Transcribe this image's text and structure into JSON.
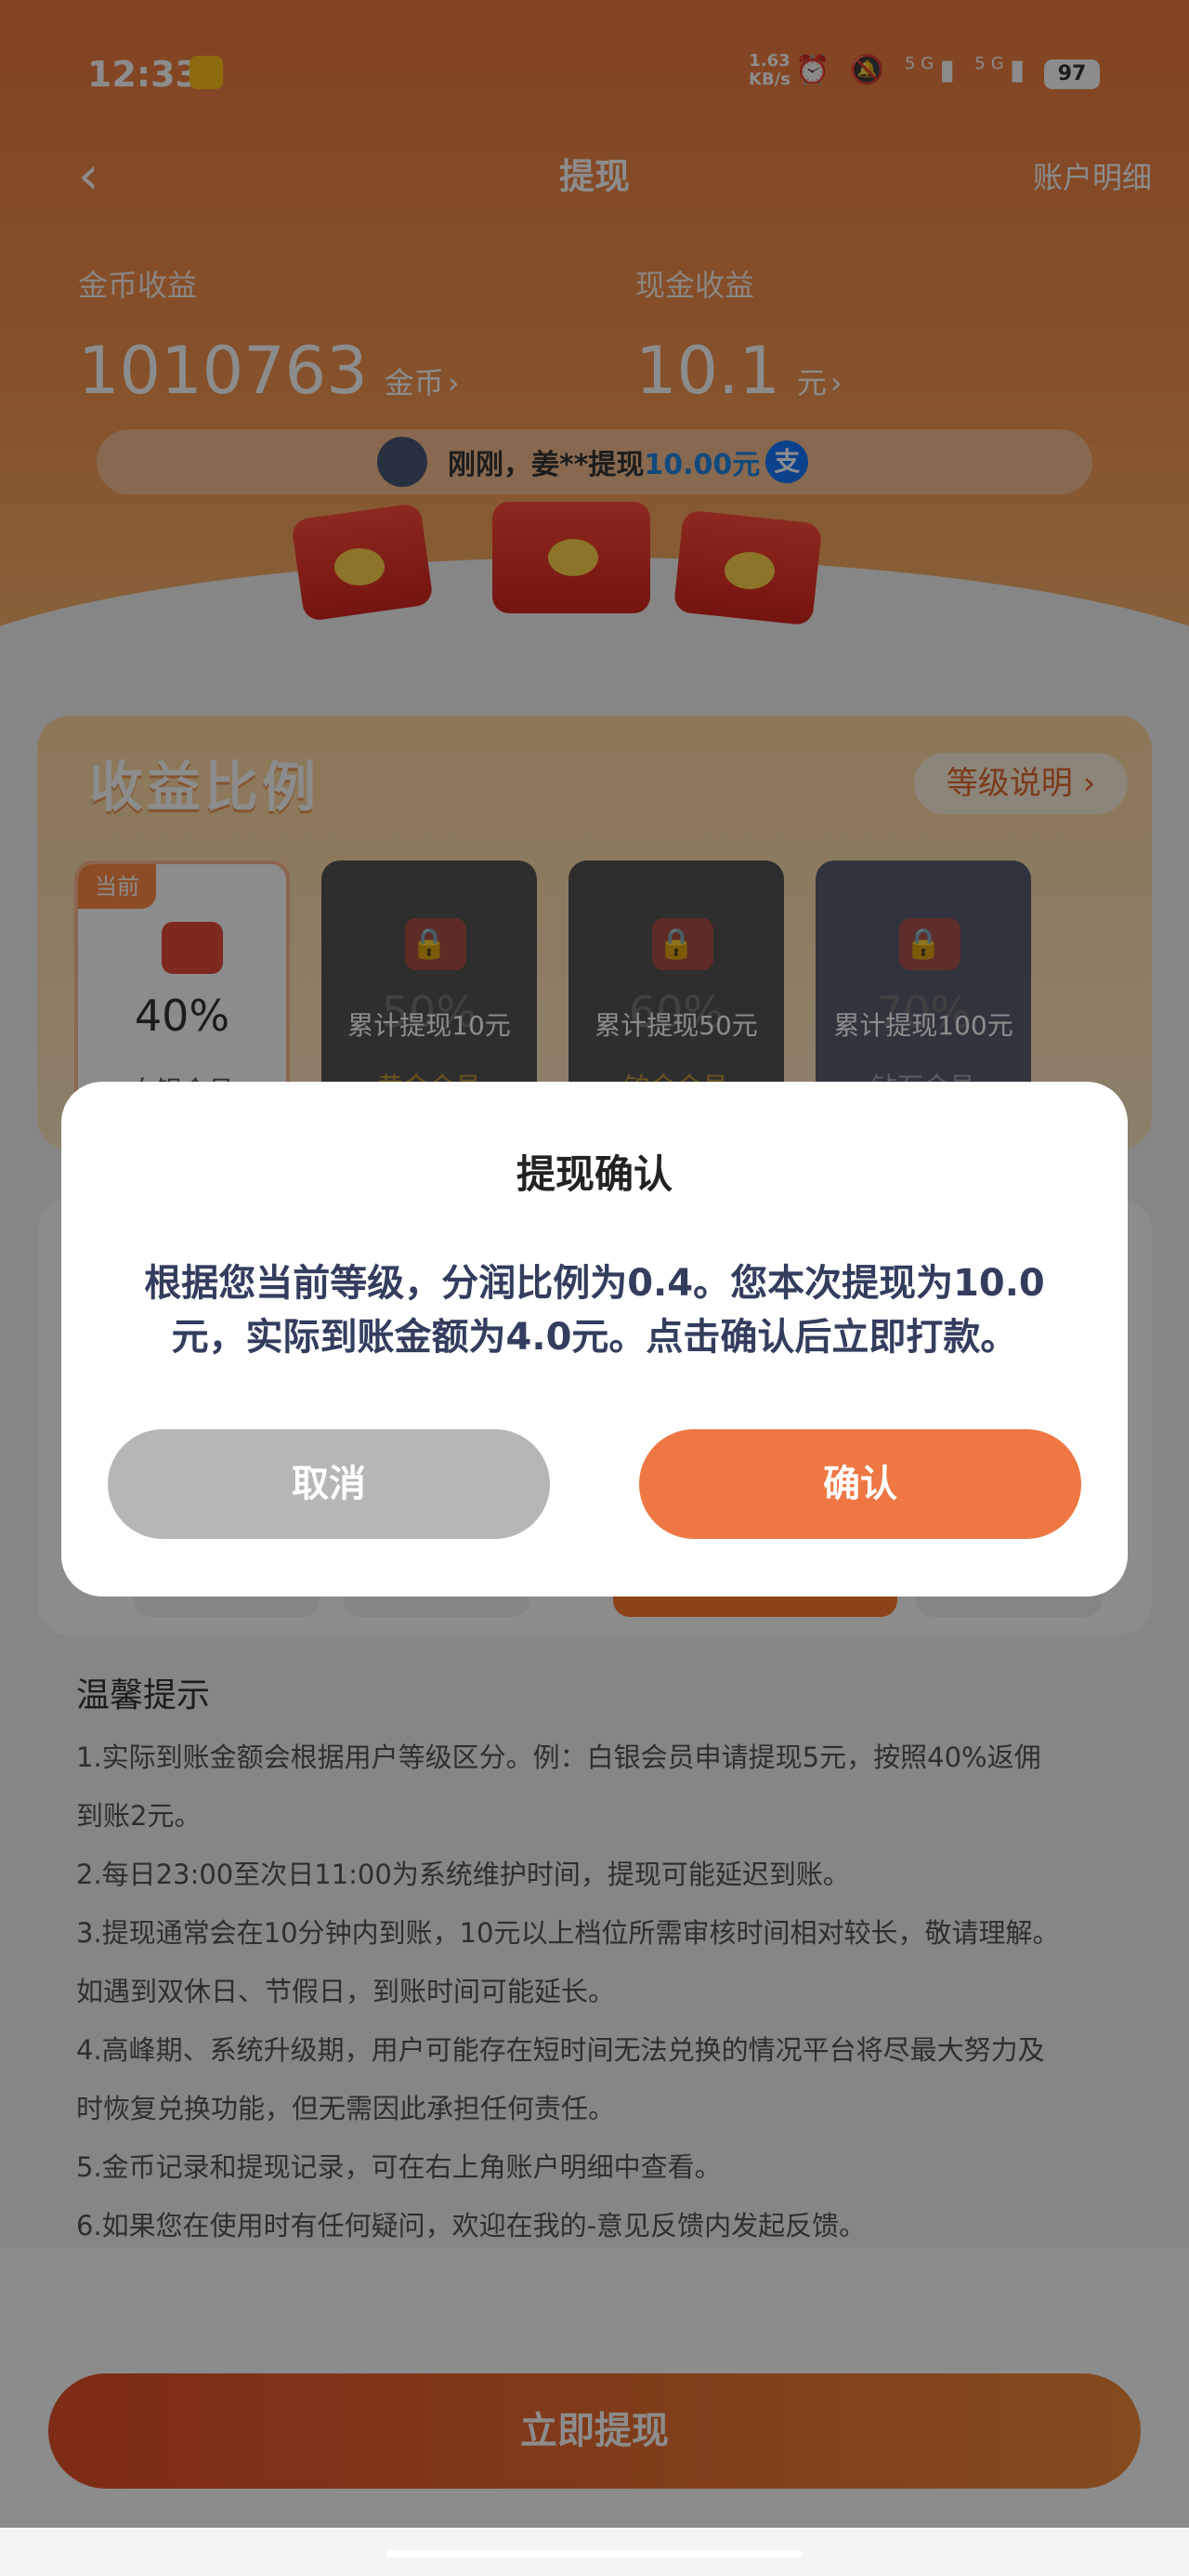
{
  "status_bar": {
    "time": "12:33",
    "net_speed_value": "1.63",
    "net_speed_unit": "KB/s",
    "signal_1": "5G",
    "signal_2": "5G",
    "battery": "97",
    "icons": [
      "alarm-icon",
      "mute-icon",
      "signal-icon",
      "signal-icon",
      "wifi-icon"
    ]
  },
  "header": {
    "title": "提现",
    "back_icon": "chevron-left-icon",
    "right_link": "账户明细"
  },
  "earnings": {
    "coin_label": "金币收益",
    "coin_value": "1010763",
    "coin_unit": "金币",
    "cash_label": "现金收益",
    "cash_value": "10.1",
    "cash_unit": "元"
  },
  "ticker": {
    "prefix": "刚刚，姜**提现",
    "amount": "10.00元",
    "pay_icon_text": "支"
  },
  "ratio": {
    "title": "收益比例",
    "level_button": "等级说明 ›",
    "levels": [
      {
        "tag": "当前",
        "percent": "40%",
        "name": "白银会员",
        "condition": ""
      },
      {
        "tag": "",
        "percent": "50%",
        "name": "黄金会员",
        "condition": "累计提现10元"
      },
      {
        "tag": "",
        "percent": "60%",
        "name": "铂金会员",
        "condition": "累计提现50元"
      },
      {
        "tag": "",
        "percent": "70%",
        "name": "钻石会员",
        "condition": "累计提现100元"
      }
    ]
  },
  "tips": {
    "title": "温馨提示",
    "items": [
      "1.实际到账金额会根据用户等级区分。例：白银会员申请提现5元，按照40%返佣",
      "到账2元。",
      "2.每日23:00至次日11:00为系统维护时间，提现可能延迟到账。",
      "3.提现通常会在10分钟内到账，10元以上档位所需审核时间相对较长，敬请理解。",
      "如遇到双休日、节假日，到账时间可能延长。",
      "4.高峰期、系统升级期，用户可能存在短时间无法兑换的情况平台将尽最大努力及",
      "时恢复兑换功能，但无需因此承担任何责任。",
      "5.金币记录和提现记录，可在右上角账户明细中查看。",
      "6.如果您在使用时有任何疑问，欢迎在我的-意见反馈内发起反馈。"
    ]
  },
  "cta": {
    "label": "立即提现"
  },
  "dialog": {
    "title": "提现确认",
    "message_line1": "根据您当前等级，分润比例为0.4。您本次提现为10.0",
    "message_line2": "元，实际到账金额为4.0元。点击确认后立即打款。",
    "cancel": "取消",
    "confirm": "确认"
  },
  "colors": {
    "accent": "#ee7743",
    "cancel": "#b6b6b6",
    "brand_orange": "#f08a3a"
  }
}
